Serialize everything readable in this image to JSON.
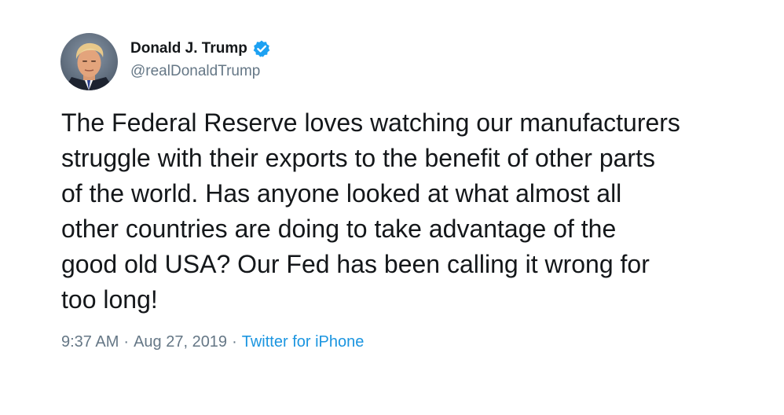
{
  "author": {
    "display_name": "Donald J. Trump",
    "handle": "@realDonaldTrump",
    "verified": true,
    "avatar_icon": "profile-photo",
    "verified_icon": "verified-badge-icon"
  },
  "tweet": {
    "text": "The Federal Reserve loves watching our manufacturers\nstruggle with their exports to the benefit of other parts\nof the world. Has anyone looked at what almost all\nother countries are doing to take advantage of the\ngood old USA? Our Fed has been calling it wrong for\ntoo long!"
  },
  "meta": {
    "time": "9:37 AM",
    "separator": "·",
    "date": "Aug 27, 2019",
    "source": "Twitter for iPhone"
  },
  "colors": {
    "text": "#14171a",
    "secondary": "#657786",
    "link": "#1b95e0",
    "verified": "#1da1f2",
    "background": "#ffffff"
  }
}
